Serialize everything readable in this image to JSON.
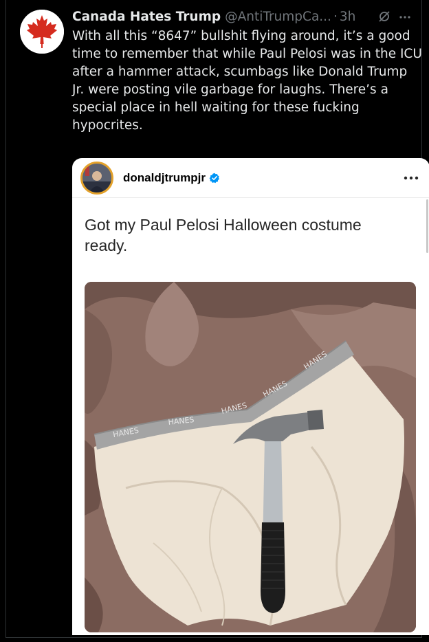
{
  "tweet": {
    "display_name": "Canada Hates Trump",
    "handle": "@AntiTrumpCa...",
    "separator": "·",
    "time": "3h",
    "text": "With all this “8647” bullshit flying around, it’s a good time to remember that while Paul Pelosi was in the ICU after a hammer attack, scumbags like Donald Trump Jr. were posting vile garbage for laughs. There’s a special place in hell waiting for these fucking hypocrites."
  },
  "quoted_post": {
    "username": "donaldjtrumpjr",
    "verified": true,
    "caption": "Got my Paul Pelosi Halloween costume ready.",
    "photo_waistband_text": "HANES"
  },
  "colors": {
    "background": "#000000",
    "text_primary": "#e7e9ea",
    "text_secondary": "#71767b",
    "verified_blue": "#0095f6",
    "story_ring": "#e3a12a",
    "maple_leaf_red": "#d52b1e"
  },
  "icons": {
    "avatar": "canada-maple-leaf-icon",
    "header_action": "grok-icon",
    "header_more": "more-horizontal-icon",
    "verified": "verified-badge-icon",
    "quote_more": "more-horizontal-icon"
  }
}
